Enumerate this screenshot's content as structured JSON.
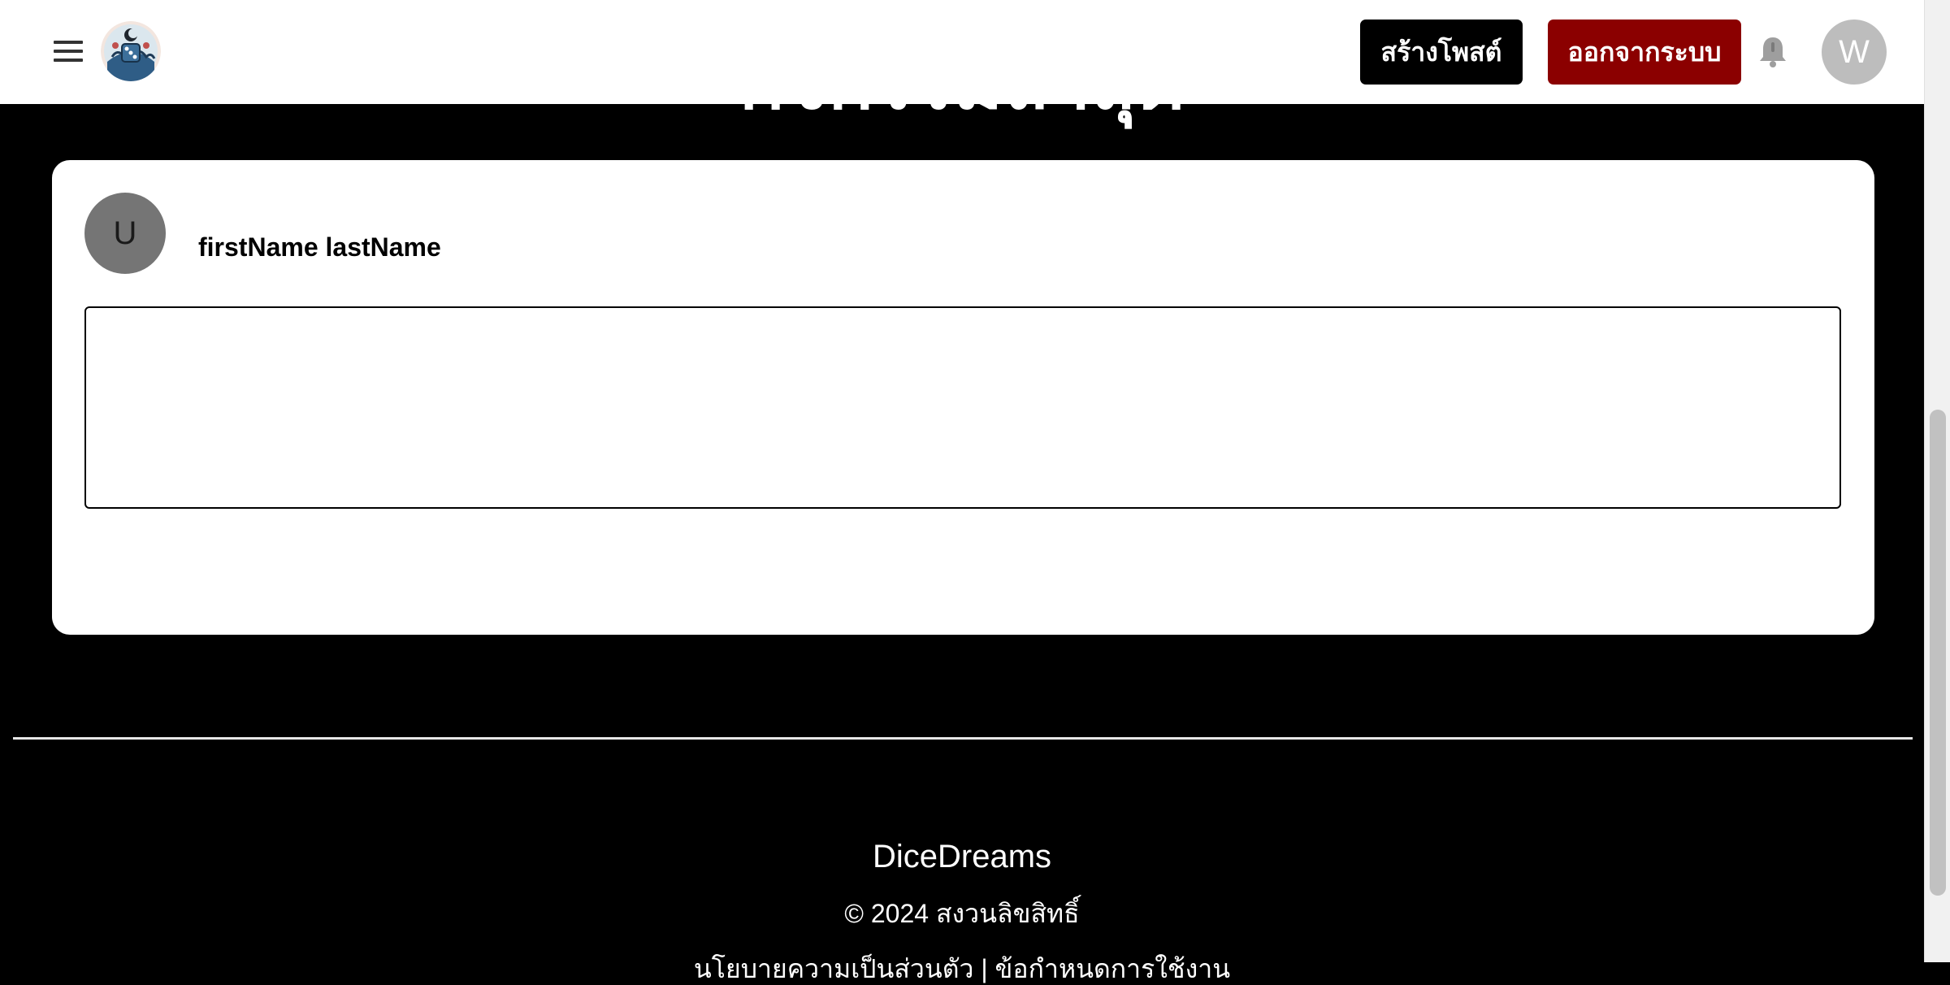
{
  "page": {
    "heading": "กิจกรรมล่าสุด",
    "background_color": "#000000"
  },
  "header": {
    "menu_icon": "hamburger-menu-icon",
    "logo_icon": "dice-octopus-logo",
    "create_post_label": "สร้างโพสต์",
    "logout_label": "ออกจากระบบ",
    "logout_color": "#8b0000",
    "notification_icon": "bell-icon",
    "user_initial": "W"
  },
  "card": {
    "avatar_initial": "U",
    "author_name": "firstName lastName",
    "content_value": ""
  },
  "footer": {
    "brand": "DiceDreams",
    "copyright": "© 2024 สงวนลิขสิทธิ์",
    "links_text": "นโยบายความเป็นส่วนตัว | ข้อกำหนดการใช้งาน"
  }
}
